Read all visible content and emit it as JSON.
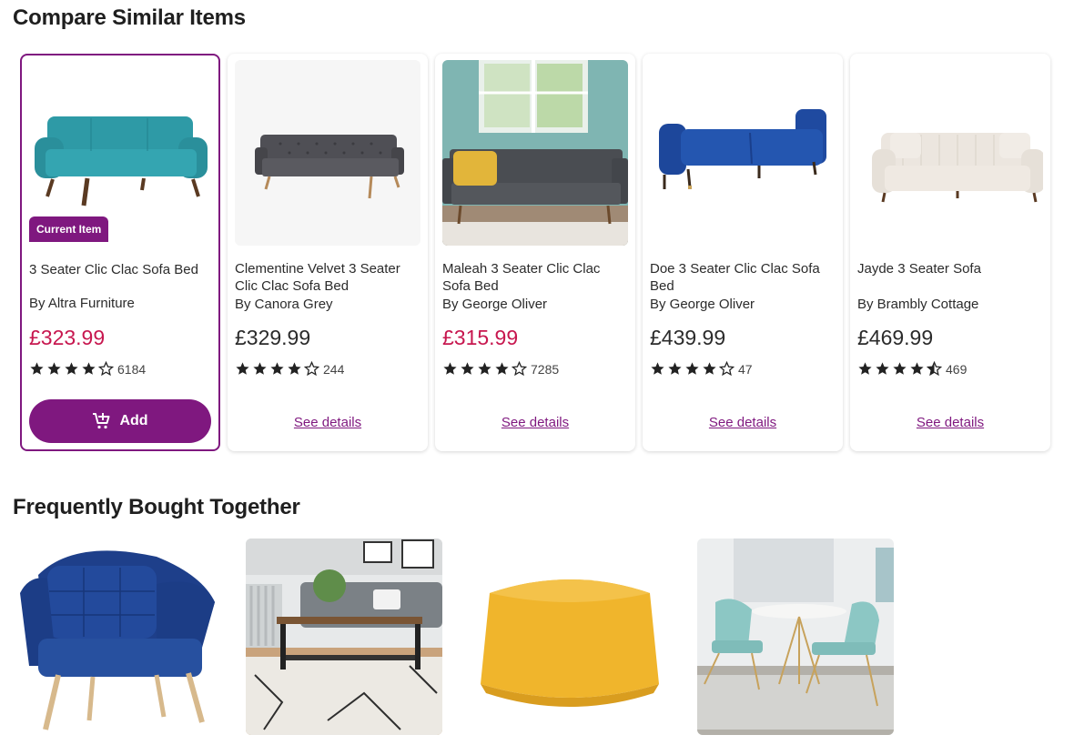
{
  "sections": {
    "compare_title": "Compare Similar Items",
    "fbt_title": "Frequently Bought Together"
  },
  "compare": {
    "current_badge": "Current Item",
    "add_label": "Add",
    "see_details_label": "See details",
    "items": [
      {
        "name": "3 Seater Clic Clac Sofa Bed",
        "brand": "By Altra Furniture",
        "price": "£323.99",
        "sale": true,
        "rating": 4,
        "reviews": "6184",
        "image": "teal-sofa-bed"
      },
      {
        "name": "Clementine Velvet 3 Seater Clic Clac Sofa Bed",
        "brand": "By Canora Grey",
        "price": "£329.99",
        "sale": false,
        "rating": 4,
        "reviews": "244",
        "image": "grey-tufted-sofa-bed"
      },
      {
        "name": "Maleah 3 Seater Clic Clac Sofa Bed",
        "brand": "By George Oliver",
        "price": "£315.99",
        "sale": true,
        "rating": 4,
        "reviews": "7285",
        "image": "grey-sofa-bed-room"
      },
      {
        "name": "Doe 3 Seater Clic Clac Sofa Bed",
        "brand": "By George Oliver",
        "price": "£439.99",
        "sale": false,
        "rating": 4,
        "reviews": "47",
        "image": "blue-velvet-sofa-bed"
      },
      {
        "name": "Jayde 3 Seater Sofa",
        "brand": "By Brambly Cottage",
        "price": "£469.99",
        "sale": false,
        "rating": 4.5,
        "reviews": "469",
        "image": "cream-sofa"
      }
    ]
  },
  "fbt_items": [
    {
      "image": "navy-velvet-armchair"
    },
    {
      "image": "coffee-table-living-room"
    },
    {
      "image": "mustard-pouffe"
    },
    {
      "image": "dining-set-teal-chairs"
    }
  ],
  "colors": {
    "brand_purple": "#7f187f",
    "sale_red": "#c7174f",
    "star": "#222222"
  },
  "icons": {
    "add_to_cart": "cart-plus-icon",
    "star_full": "star-icon",
    "star_empty": "star-outline-icon",
    "star_half": "star-half-icon"
  }
}
